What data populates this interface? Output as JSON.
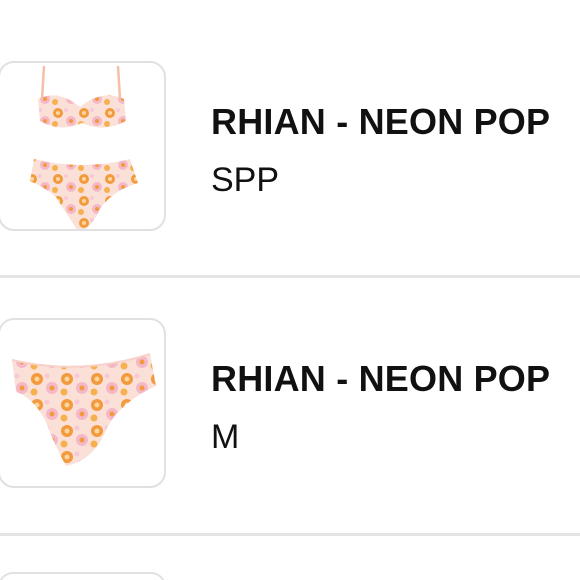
{
  "colors": {
    "divider": "#e4e4e4",
    "card_border": "#e1e1e1",
    "text": "#111111",
    "print_pink": "#f7c6d0",
    "print_orange": "#f29a3c",
    "print_peach": "#fbe3d6"
  },
  "cart": {
    "items": [
      {
        "title": "RHIAN - NEON POP",
        "variant": "SPP",
        "image": "bikini-set-image"
      },
      {
        "title": "RHIAN - NEON POP",
        "variant": "M",
        "image": "bikini-bottom-image"
      }
    ]
  }
}
